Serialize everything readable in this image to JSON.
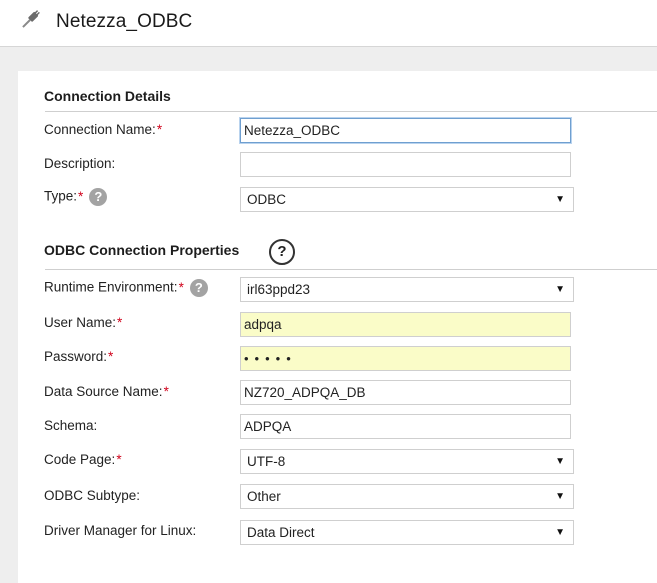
{
  "header": {
    "title": "Netezza_ODBC",
    "icon": "plug-icon"
  },
  "connection_details": {
    "heading": "Connection Details",
    "connection_name": {
      "label": "Connection Name:",
      "required": "*",
      "value": "Netezza_ODBC"
    },
    "description": {
      "label": "Description:",
      "value": ""
    },
    "type": {
      "label": "Type:",
      "required": "*",
      "help": "?",
      "value": "ODBC"
    }
  },
  "odbc_properties": {
    "heading": "ODBC Connection Properties",
    "help": "?",
    "runtime_environment": {
      "label": "Runtime Environment:",
      "required": "*",
      "help": "?",
      "value": "irl63ppd23"
    },
    "user_name": {
      "label": "User Name:",
      "required": "*",
      "value": "adpqa"
    },
    "password": {
      "label": "Password:",
      "required": "*",
      "value": "•••••"
    },
    "data_source_name": {
      "label": "Data Source Name:",
      "required": "*",
      "value": "NZ720_ADPQA_DB"
    },
    "schema": {
      "label": "Schema:",
      "value": "ADPQA"
    },
    "code_page": {
      "label": "Code Page:",
      "required": "*",
      "value": "UTF-8"
    },
    "odbc_subtype": {
      "label": "ODBC Subtype:",
      "value": "Other"
    },
    "driver_manager": {
      "label": "Driver Manager for Linux:",
      "value": "Data Direct"
    }
  },
  "dropdown_arrow": "▼",
  "colors": {
    "required": "#d0021b",
    "autofill_yellow": "#fafcc8",
    "focus_border": "#6f9fd0",
    "page_background": "#eeeeee"
  }
}
